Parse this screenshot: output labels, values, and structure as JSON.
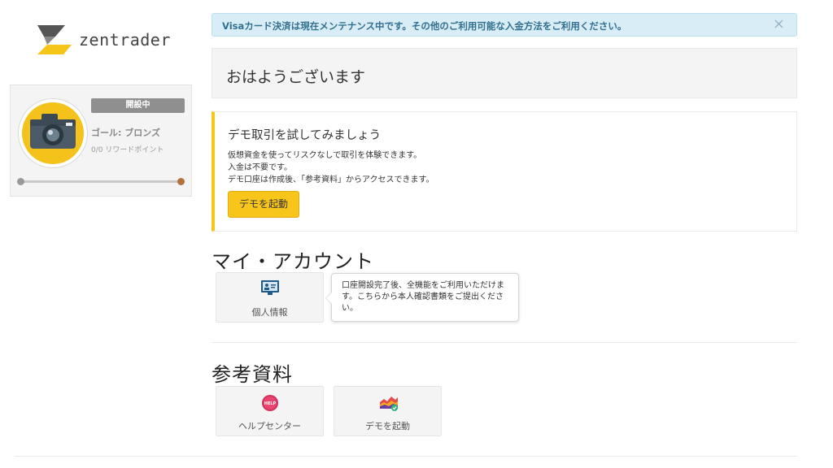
{
  "brand": {
    "name": "zentrader",
    "colors": {
      "accent": "#f5c518",
      "info": "#31708f",
      "info_bg": "#d9edf7"
    }
  },
  "profile": {
    "status": "開設中",
    "goal": "ゴール: ブロンズ",
    "reward_points": "0/0 リワードポイント",
    "progress": 1.0,
    "avatar_icon": "camera-icon"
  },
  "alert": {
    "message": "Visaカード決済は現在メンテナンス中です。その他のご利用可能な入金方法をご利用ください。",
    "close_label": "×"
  },
  "greeting": "おはようございます",
  "demo": {
    "title": "デモ取引を試してみましょう",
    "lines": [
      "仮想資金を使ってリスクなしで取引を体験できます。",
      "入金は不要です。",
      "デモ口座は作成後、「参考資料」からアクセスできます。"
    ],
    "button_label": "デモを起動"
  },
  "my_account": {
    "title": "マイ・アカウント",
    "tiles": [
      {
        "label": "個人情報",
        "icon": "id-card-icon"
      }
    ],
    "tooltip": "口座開設完了後、全機能をご利用いただけます。こちらから本人確認書類をご提出ください。"
  },
  "resources": {
    "title": "参考資料",
    "tiles": [
      {
        "label": "ヘルプセンター",
        "icon": "help-badge-icon",
        "icon_text": "HELP"
      },
      {
        "label": "デモを起動",
        "icon": "demo-chart-icon"
      }
    ]
  }
}
